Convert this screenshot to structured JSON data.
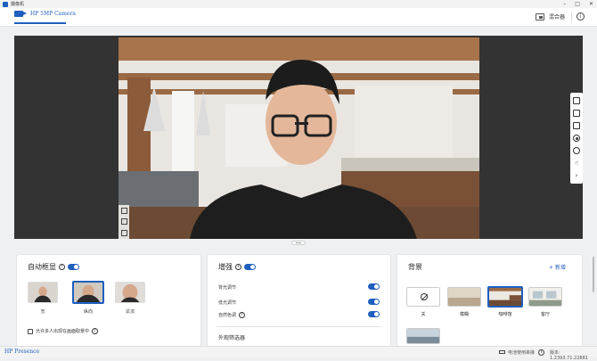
{
  "titlebar": {
    "app_name": "摄像机"
  },
  "header": {
    "tab_label": "HP 5MP Camera",
    "mixer_label": "混合器"
  },
  "framing": {
    "title": "自动框显",
    "enabled": true,
    "options": [
      {
        "label": "宽",
        "selected": false
      },
      {
        "label": "纵向",
        "selected": true
      },
      {
        "label": "紧凑",
        "selected": false
      }
    ],
    "multi_person_label": "允许多人出现在画面取景中"
  },
  "enhance": {
    "title": "增强",
    "enabled": true,
    "rows": [
      {
        "label": "背光调节",
        "enabled": true
      },
      {
        "label": "低光调节",
        "enabled": true
      },
      {
        "label": "自然色调",
        "enabled": true
      }
    ],
    "filters_label": "外观筛选器"
  },
  "background": {
    "title": "背景",
    "add_label": "+ 新增",
    "options": [
      {
        "label": "关",
        "selected": false
      },
      {
        "label": "模糊",
        "selected": false
      },
      {
        "label": "咖啡馆",
        "selected": true
      },
      {
        "label": "客厅",
        "selected": false
      }
    ]
  },
  "footer": {
    "brand": "HP Presence",
    "power_label": "电池使用串接",
    "version": "版本: 1.2393.71.22881"
  },
  "icons": {
    "sidebar": [
      "crop-icon",
      "image-icon",
      "camera-icon",
      "record-icon",
      "broadcast-icon",
      "thumbs-up-icon",
      "chevron-right-icon"
    ]
  },
  "colors": {
    "accent": "#1f5fbf"
  }
}
